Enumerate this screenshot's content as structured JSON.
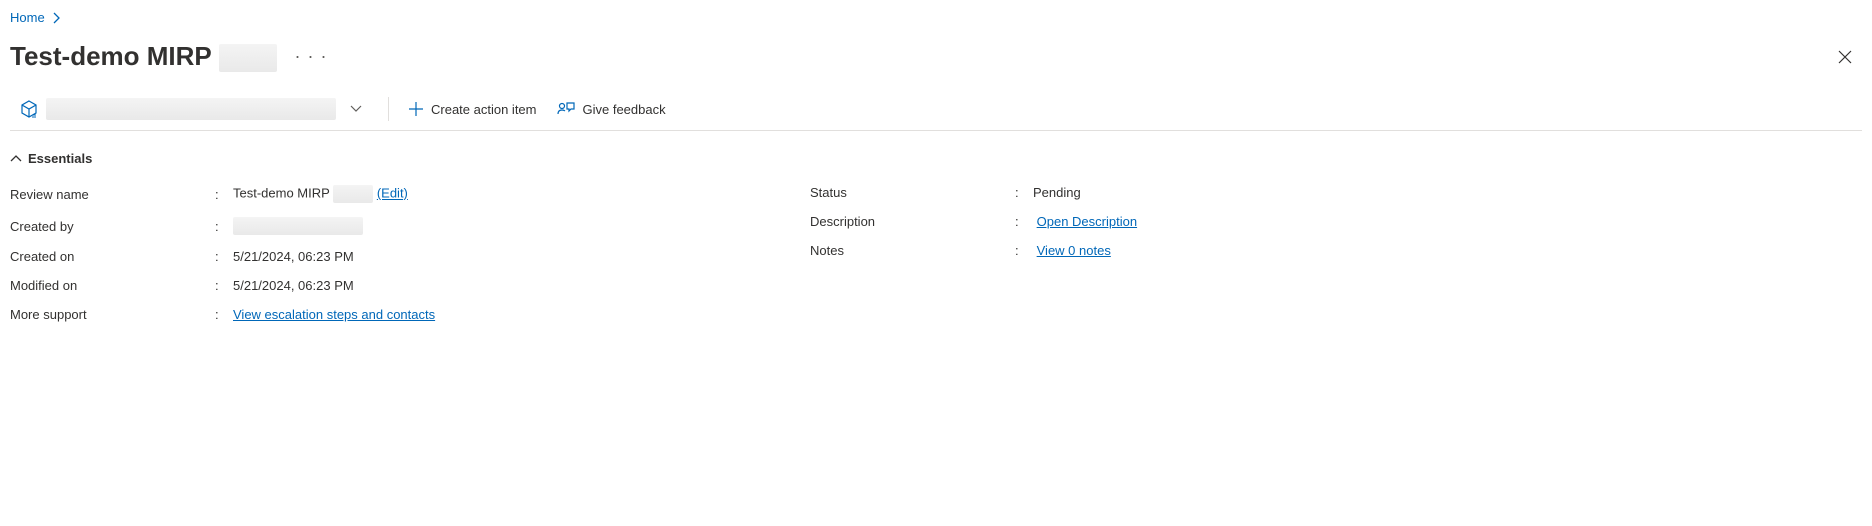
{
  "breadcrumb": {
    "home": "Home"
  },
  "header": {
    "title": "Test-demo MIRP"
  },
  "toolbar": {
    "create_action_item": "Create action item",
    "give_feedback": "Give feedback"
  },
  "essentials": {
    "section_title": "Essentials",
    "left": {
      "review_name_label": "Review name",
      "review_name_value": "Test-demo MIRP",
      "edit_link": "(Edit)",
      "created_by_label": "Created by",
      "created_on_label": "Created on",
      "created_on_value": "5/21/2024, 06:23 PM",
      "modified_on_label": "Modified on",
      "modified_on_value": "5/21/2024, 06:23 PM",
      "more_support_label": "More support",
      "more_support_link": "View escalation steps and contacts"
    },
    "right": {
      "status_label": "Status",
      "status_value": "Pending",
      "description_label": "Description",
      "description_link": "Open Description",
      "notes_label": "Notes",
      "notes_link": "View 0 notes"
    }
  }
}
